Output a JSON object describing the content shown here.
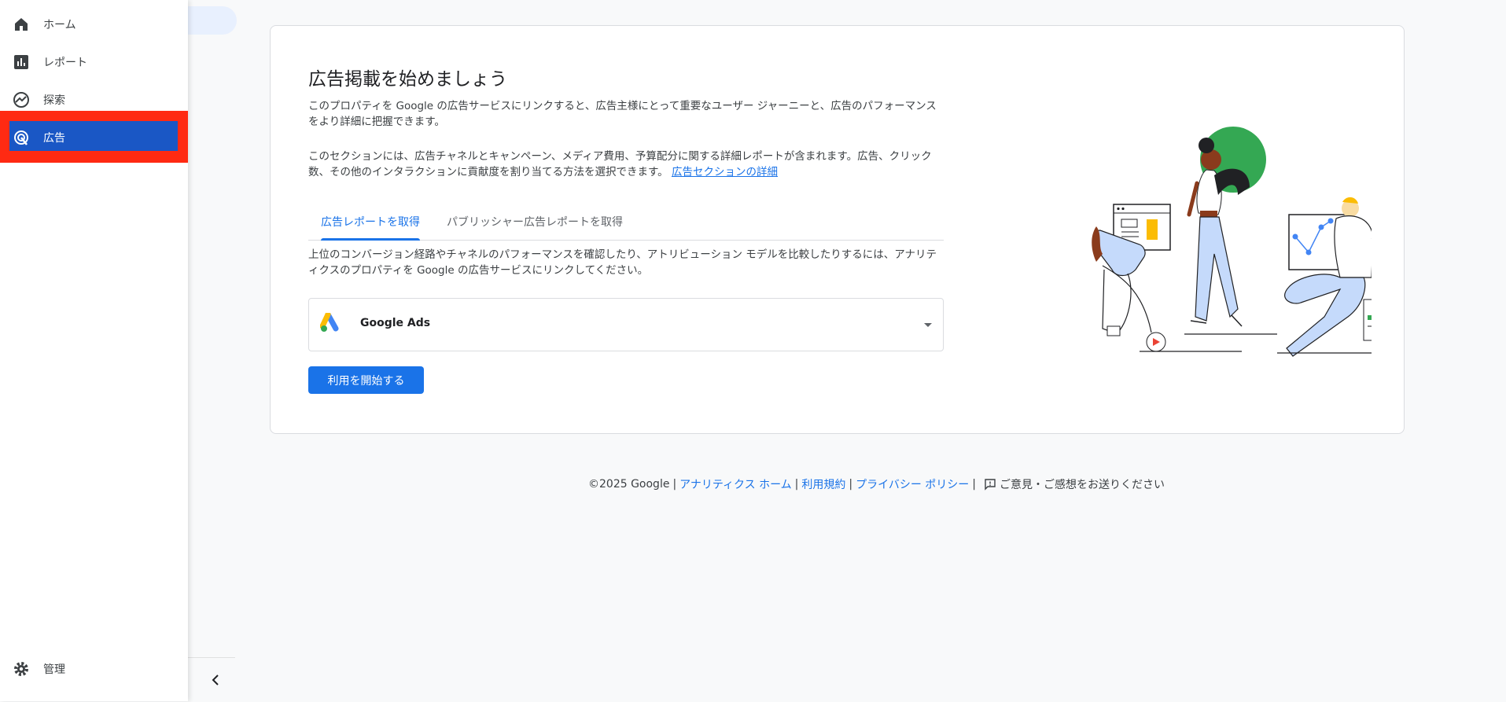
{
  "sidebar": {
    "items": [
      {
        "label": "ホーム",
        "icon": "home-icon"
      },
      {
        "label": "レポート",
        "icon": "bar-chart-icon"
      },
      {
        "label": "探索",
        "icon": "explore-icon"
      },
      {
        "label": "広告",
        "icon": "advertising-icon"
      }
    ],
    "admin_label": "管理"
  },
  "main": {
    "title": "広告掲載を始めましょう",
    "intro": "このプロパティを Google の広告サービスにリンクすると、広告主様にとって重要なユーザー ジャーニーと、広告のパフォーマンスをより詳細に把握できます。",
    "section_desc": "このセクションには、広告チャネルとキャンペーン、メディア費用、予算配分に関する詳細レポートが含まれます。広告、クリック数、その他のインタラクションに貢献度を割り当てる方法を選択できます。",
    "section_link": "広告セクションの詳細",
    "tabs": [
      {
        "label": "広告レポートを取得"
      },
      {
        "label": "パブリッシャー広告レポートを取得"
      }
    ],
    "tab_desc": "上位のコンバージョン経路やチャネルのパフォーマンスを確認したり、アトリビューション モデルを比較したりするには、アナリティクスのプロパティを Google の広告サービスにリンクしてください。",
    "product_select": "Google Ads",
    "start_button": "利用を開始する"
  },
  "footer": {
    "copyright": "©2025 Google",
    "sep": "|",
    "links": [
      "アナリティクス ホーム",
      "利用規約",
      "プライバシー ポリシー"
    ],
    "feedback": "ご意見・ご感想をお送りください"
  },
  "colors": {
    "accent": "#1a73e8",
    "highlight_box": "#ff2a12",
    "active_nav": "#1a57c5"
  }
}
